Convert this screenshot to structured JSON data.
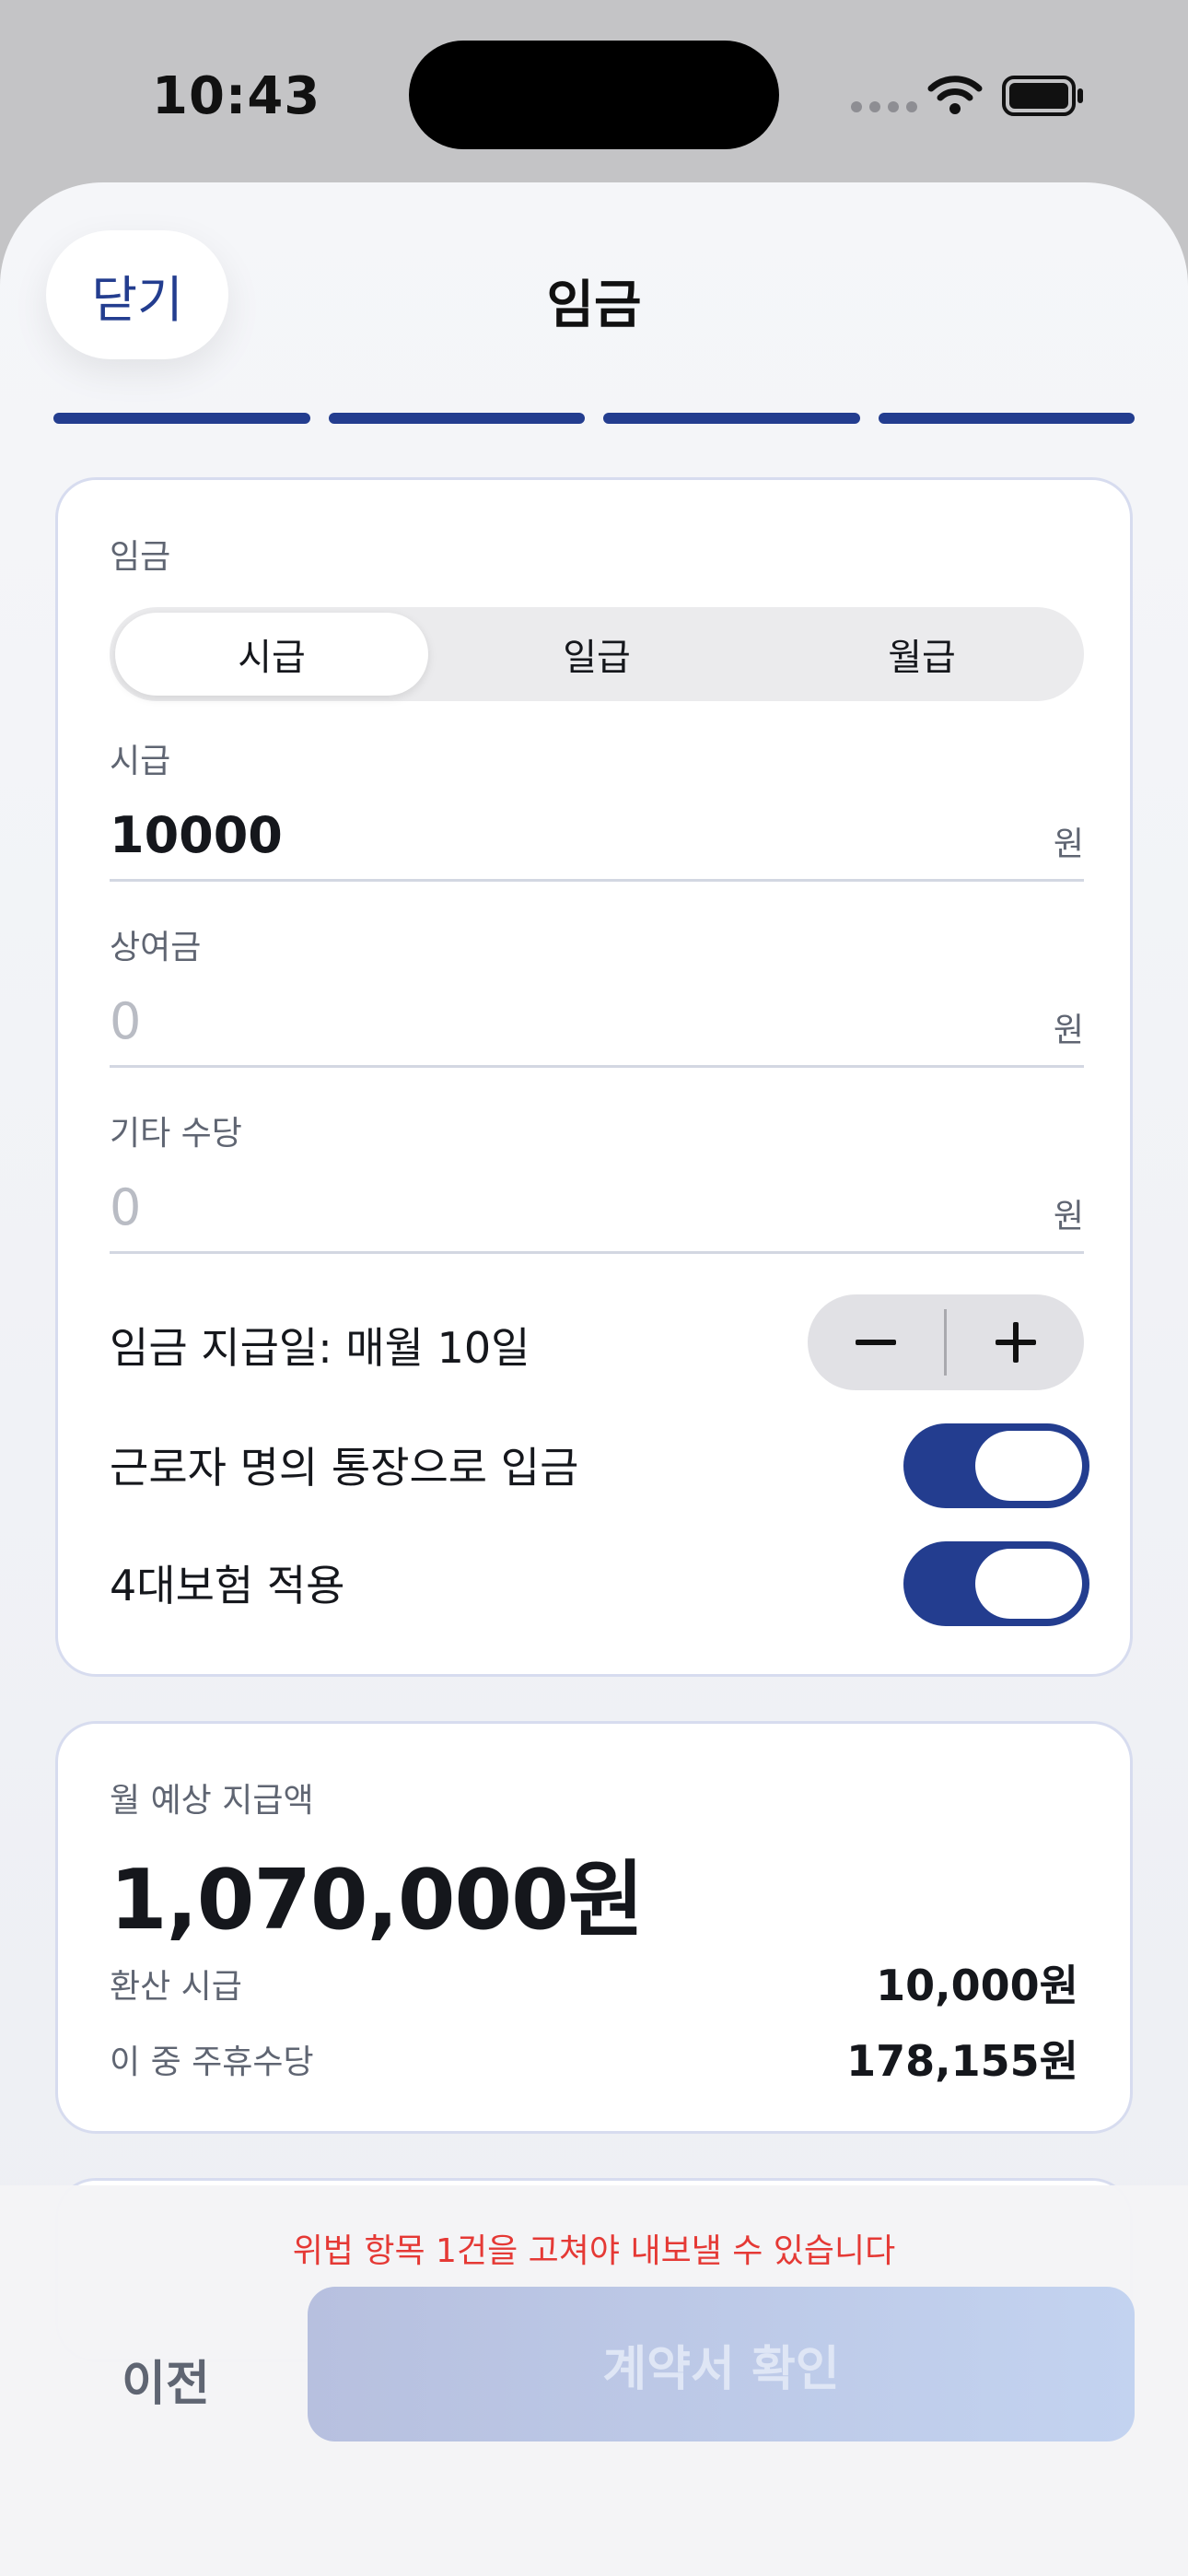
{
  "status_bar": {
    "time": "10:43"
  },
  "header": {
    "close_label": "닫기",
    "title": "임금"
  },
  "progress": {
    "steps_total": 4,
    "steps_completed": 4
  },
  "wage_card": {
    "section_label": "임금",
    "segments": [
      {
        "label": "시급",
        "selected": true
      },
      {
        "label": "일급",
        "selected": false
      },
      {
        "label": "월급",
        "selected": false
      }
    ],
    "hourly": {
      "label": "시급",
      "value": "10000",
      "unit": "원"
    },
    "bonus": {
      "label": "상여금",
      "placeholder": "0",
      "unit": "원"
    },
    "allowance": {
      "label": "기타 수당",
      "placeholder": "0",
      "unit": "원"
    },
    "payday_text": "임금 지급일: 매월 10일",
    "deposit": {
      "label": "근로자 명의 통장으로 입금",
      "on": true
    },
    "insurance": {
      "label": "4대보험 적용",
      "on": true
    }
  },
  "summary_card": {
    "label": "월 예상 지급액",
    "amount": "1,070,000원",
    "rows": [
      {
        "key": "환산 시급",
        "value": "10,000원"
      },
      {
        "key": "이 중 주휴수당",
        "value": "178,155원"
      }
    ]
  },
  "bottom_bar": {
    "warning": "위법 항목 1건을 고쳐야 내보낼 수 있습니다",
    "prev_label": "이전",
    "confirm_label": "계약서 확인"
  },
  "colors": {
    "accent": "#233d8f",
    "warning": "#e53935"
  }
}
